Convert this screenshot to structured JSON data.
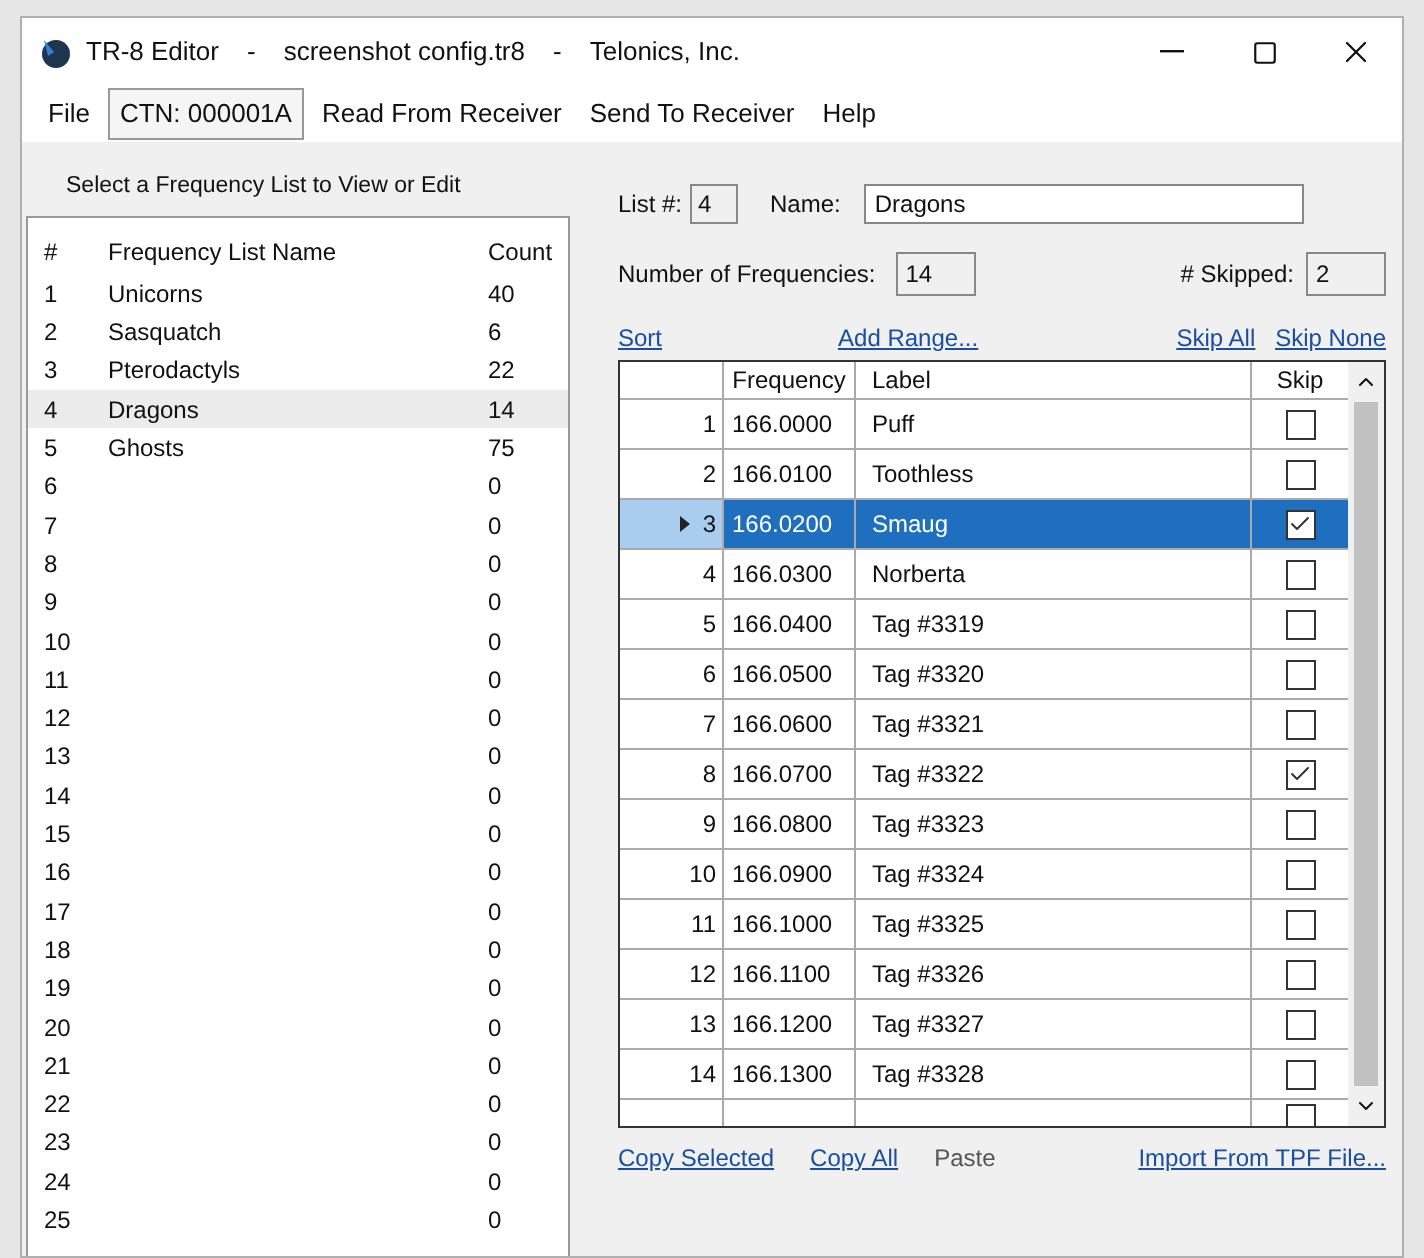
{
  "window": {
    "title": "TR-8 Editor",
    "separator_1": "-",
    "file": "screenshot config.tr8",
    "separator_2": "-",
    "company": "Telonics, Inc."
  },
  "menu": [
    {
      "label": "File",
      "kind": "item"
    },
    {
      "label": "CTN:  000001A",
      "kind": "boxed"
    },
    {
      "label": "Read From Receiver",
      "kind": "item"
    },
    {
      "label": "Send To Receiver",
      "kind": "item"
    },
    {
      "label": "Help",
      "kind": "item"
    }
  ],
  "list_prompt": "Select a Frequency List to View or Edit",
  "lists": {
    "columns": [
      "#",
      "Frequency List Name",
      "Count"
    ],
    "rows": [
      {
        "num": "1",
        "name": "Unicorns",
        "count": "40",
        "selected": false
      },
      {
        "num": "2",
        "name": "Sasquatch",
        "count": "6",
        "selected": false
      },
      {
        "num": "3",
        "name": "Pterodactyls",
        "count": "22",
        "selected": false
      },
      {
        "num": "4",
        "name": "Dragons",
        "count": "14",
        "selected": true
      },
      {
        "num": "5",
        "name": "Ghosts",
        "count": "75",
        "selected": false
      },
      {
        "num": "6",
        "count": "0",
        "selected": false
      },
      {
        "num": "7",
        "count": "0",
        "selected": false
      },
      {
        "num": "8",
        "count": "0",
        "selected": false
      },
      {
        "num": "9",
        "count": "0",
        "selected": false
      },
      {
        "num": "10",
        "count": "0",
        "selected": false
      },
      {
        "num": "11",
        "count": "0",
        "selected": false
      },
      {
        "num": "12",
        "count": "0",
        "selected": false
      },
      {
        "num": "13",
        "count": "0",
        "selected": false
      },
      {
        "num": "14",
        "count": "0",
        "selected": false
      },
      {
        "num": "15",
        "count": "0",
        "selected": false
      },
      {
        "num": "16",
        "count": "0",
        "selected": false
      },
      {
        "num": "17",
        "count": "0",
        "selected": false
      },
      {
        "num": "18",
        "count": "0",
        "selected": false
      },
      {
        "num": "19",
        "count": "0",
        "selected": false
      },
      {
        "num": "20",
        "count": "0",
        "selected": false
      },
      {
        "num": "21",
        "count": "0",
        "selected": false
      },
      {
        "num": "22",
        "count": "0",
        "selected": false
      },
      {
        "num": "23",
        "count": "0",
        "selected": false
      },
      {
        "num": "24",
        "count": "0",
        "selected": false
      },
      {
        "num": "25",
        "count": "0",
        "selected": false
      }
    ]
  },
  "editor": {
    "list_label": "List #:",
    "list_value": "4",
    "name_label": "Name:",
    "name_value": "Dragons",
    "count_label": "Number of Frequencies:",
    "count_value": "14",
    "skipped_label": "# Skipped:",
    "skipped_value": "2",
    "links": [
      "Sort",
      "Add Range...",
      "Skip All",
      "Skip None"
    ],
    "grid": {
      "columns": [
        "Frequency",
        "Label",
        "Skip"
      ],
      "rows": [
        {
          "num": "1",
          "frequency": "166.0000",
          "label": "Puff",
          "skip": false,
          "selected": false
        },
        {
          "num": "2",
          "frequency": "166.0100",
          "label": "Toothless",
          "skip": false,
          "selected": false
        },
        {
          "num": "3",
          "frequency": "166.0200",
          "label": "Smaug",
          "skip": true,
          "selected": true
        },
        {
          "num": "4",
          "frequency": "166.0300",
          "label": "Norberta",
          "skip": false,
          "selected": false
        },
        {
          "num": "5",
          "frequency": "166.0400",
          "label": "Tag #3319",
          "skip": false,
          "selected": false
        },
        {
          "num": "6",
          "frequency": "166.0500",
          "label": "Tag #3320",
          "skip": false,
          "selected": false
        },
        {
          "num": "7",
          "frequency": "166.0600",
          "label": "Tag #3321",
          "skip": false,
          "selected": false
        },
        {
          "num": "8",
          "frequency": "166.0700",
          "label": "Tag #3322",
          "skip": true,
          "selected": false
        },
        {
          "num": "9",
          "frequency": "166.0800",
          "label": "Tag #3323",
          "skip": false,
          "selected": false
        },
        {
          "num": "10",
          "frequency": "166.0900",
          "label": "Tag #3324",
          "skip": false,
          "selected": false
        },
        {
          "num": "11",
          "frequency": "166.1000",
          "label": "Tag #3325",
          "skip": false,
          "selected": false
        },
        {
          "num": "12",
          "frequency": "166.1100",
          "label": "Tag #3326",
          "skip": false,
          "selected": false
        },
        {
          "num": "13",
          "frequency": "166.1200",
          "label": "Tag #3327",
          "skip": false,
          "selected": false
        },
        {
          "num": "14",
          "frequency": "166.1300",
          "label": "Tag #3328",
          "skip": false,
          "selected": false
        }
      ],
      "new_row": {
        "skip": false
      }
    },
    "bottom_links": [
      {
        "label": "Copy Selected",
        "disabled": false
      },
      {
        "label": "Copy All",
        "disabled": false
      },
      {
        "label": "Paste",
        "disabled": true
      },
      {
        "label": "Import From TPF File...",
        "disabled": false
      }
    ]
  }
}
